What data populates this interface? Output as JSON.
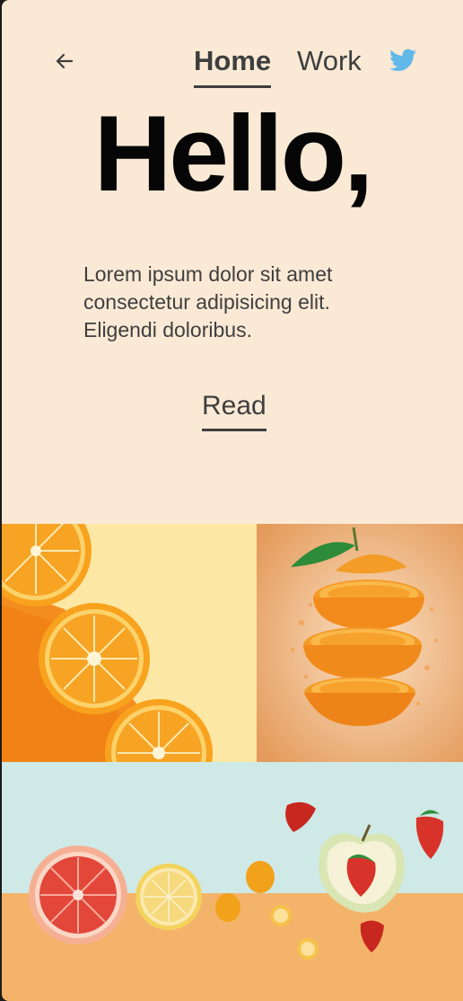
{
  "nav": {
    "back_icon": "arrow-left-icon",
    "links": [
      {
        "label": "Home",
        "active": true
      },
      {
        "label": "Work",
        "active": false
      }
    ],
    "social_icon": "twitter-icon",
    "social_color": "#61b8e9"
  },
  "hero": {
    "title": "Hello,",
    "body": "Lorem ipsum dolor sit amet consectetur adipisicing elit. Eligendi doloribus.",
    "cta": "Read"
  },
  "colors": {
    "background": "#fae9d5",
    "text": "#3e3e3e"
  }
}
